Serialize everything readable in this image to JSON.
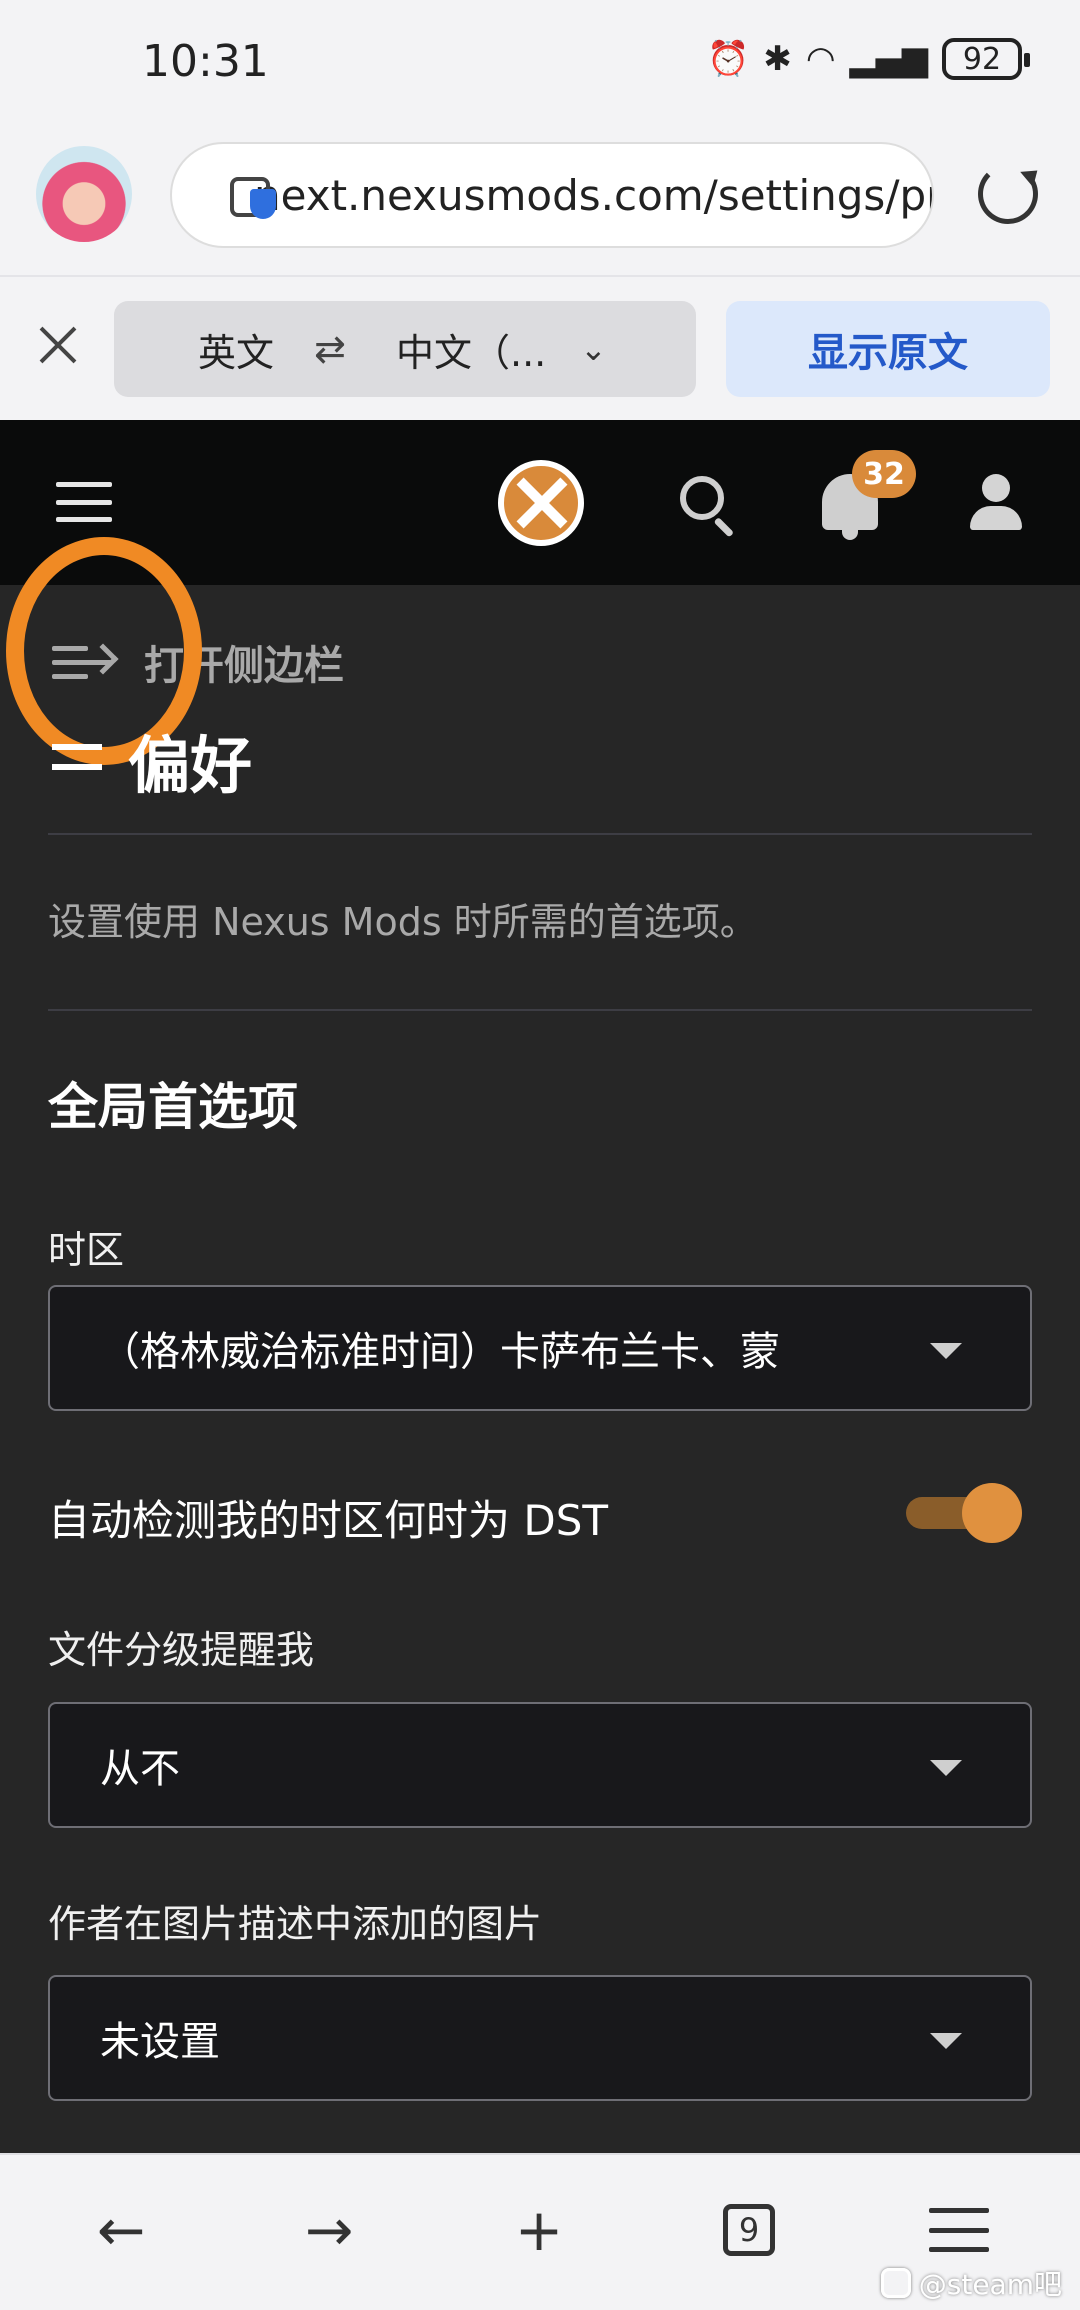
{
  "status_bar": {
    "time": "10:31",
    "icons": [
      "alarm-icon",
      "bluetooth-icon",
      "wifi-icon",
      "4g-signal-icon"
    ],
    "battery": "92"
  },
  "browser": {
    "url": "next.nexusmods.com/settings/pr",
    "tabs_count": "9"
  },
  "translate_bar": {
    "source_lang": "英文",
    "swap_symbol": "⇄",
    "target_lang": "中文（...",
    "show_original": "显示原文"
  },
  "site_header": {
    "notification_count": "32",
    "accent_color": "#d98a3a"
  },
  "page": {
    "sidebar_toggle": "打开侧边栏",
    "title": "偏好",
    "description": "设置使用 Nexus Mods 时所需的首选项。",
    "section_title": "全局首选项",
    "timezone_label": "时区",
    "timezone_value": "（格林威治标准时间）卡萨布兰卡、蒙",
    "dst_label": "自动检测我的时区何时为 DST",
    "dst_enabled": true,
    "file_rating_label": "文件分级提醒我",
    "file_rating_value": "从不",
    "author_images_label": "作者在图片描述中添加的图片",
    "author_images_value": "未设置"
  },
  "bottom_nav": {
    "back": "←",
    "forward": "→",
    "new_tab": "+"
  },
  "watermark": "@steam吧"
}
